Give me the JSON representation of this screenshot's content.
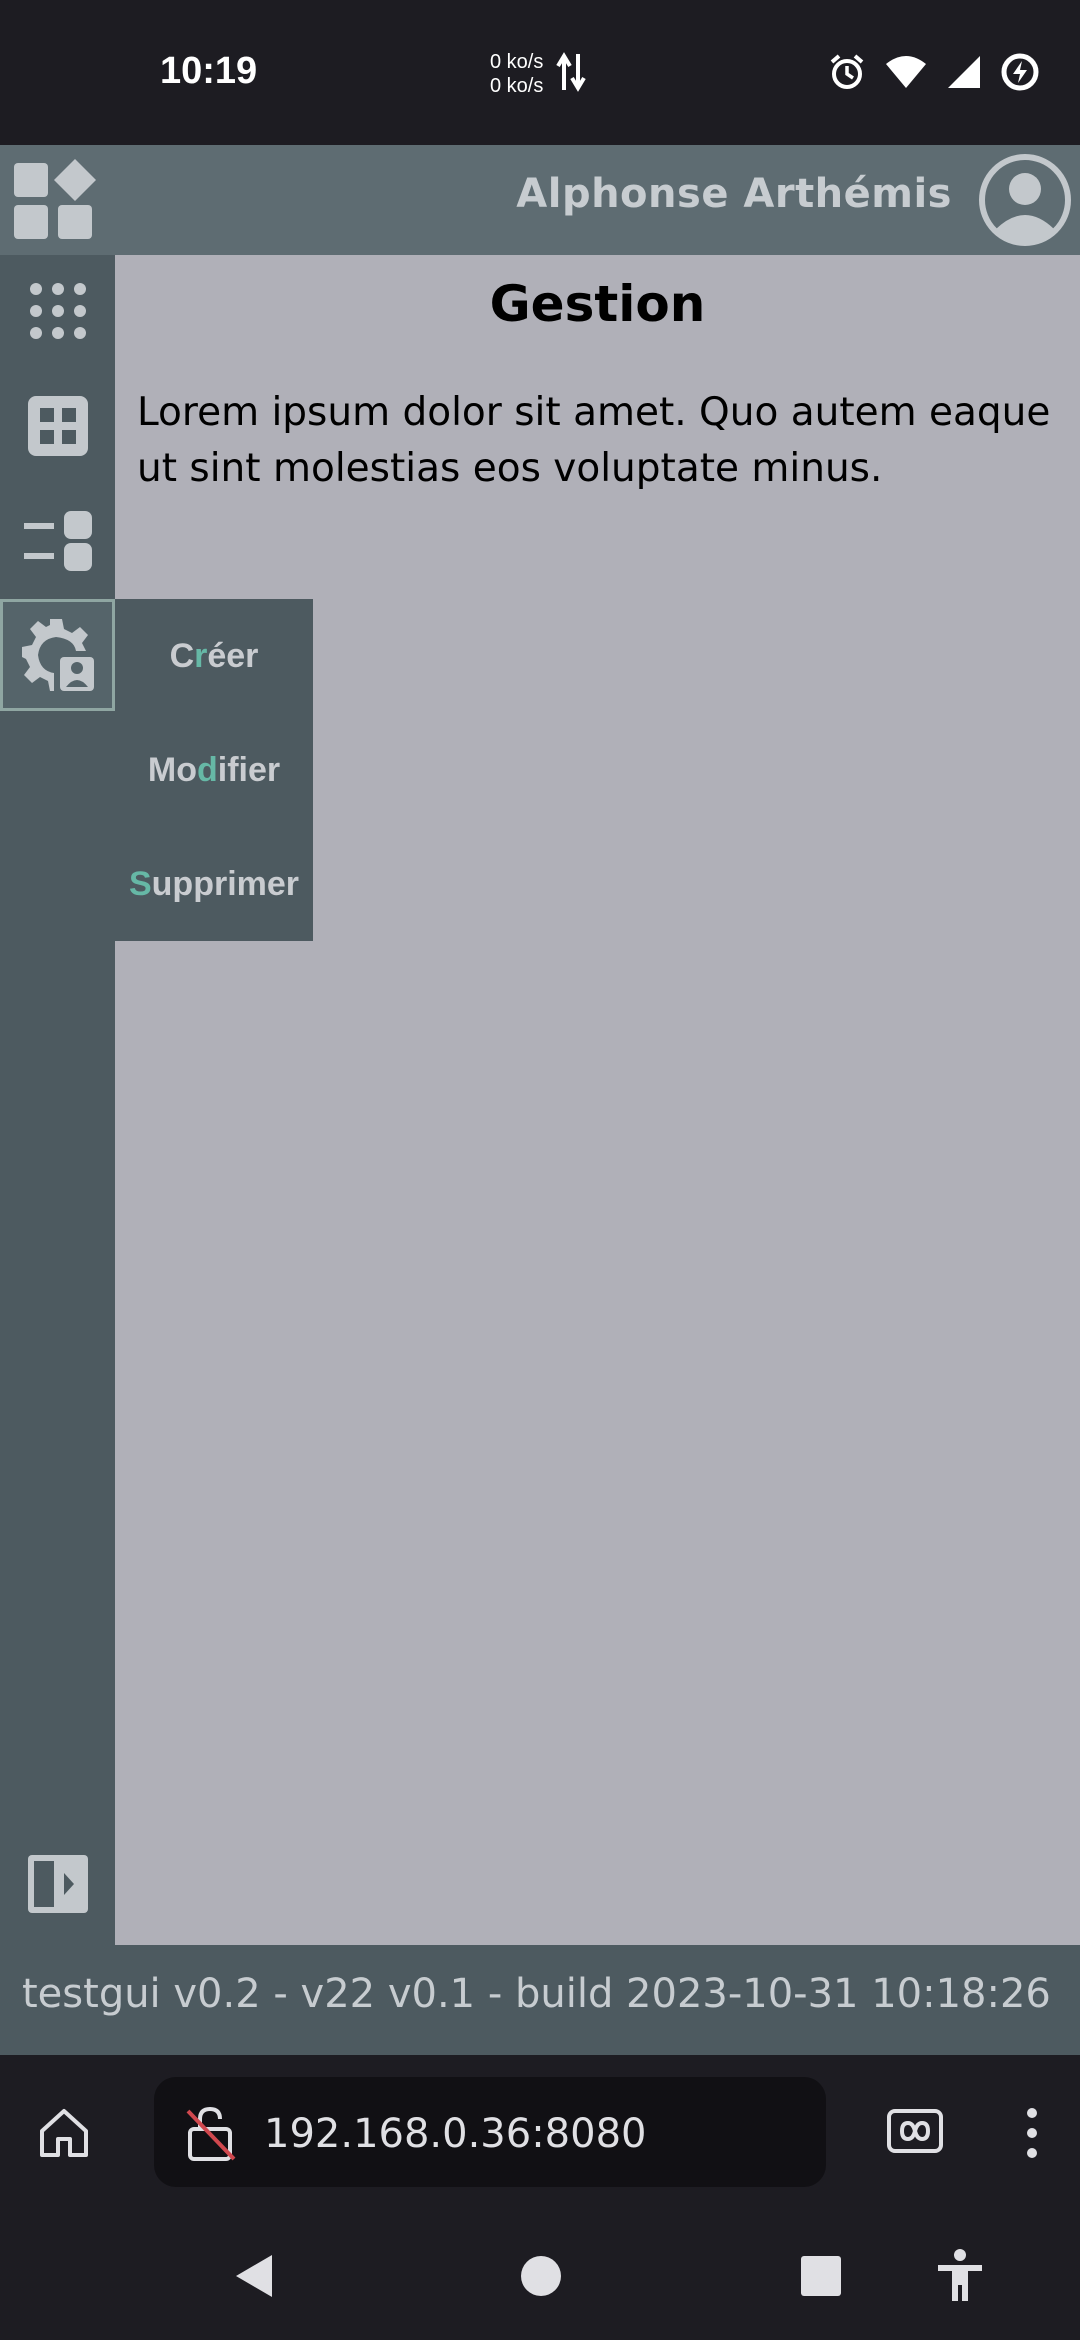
{
  "status_bar": {
    "time": "10:19",
    "net_up": "0 ko/s",
    "net_down": "0 ko/s",
    "icons": [
      "alarm-icon",
      "wifi-icon",
      "cell-signal-icon",
      "battery-saver-icon"
    ]
  },
  "header": {
    "user_name": "Alphonse Arthémis",
    "logo_icon": "apps-logo-icon",
    "avatar_icon": "user-avatar-icon"
  },
  "sidebar": {
    "items": [
      {
        "icon": "dots-grid-icon"
      },
      {
        "icon": "dashboard-grid-icon"
      },
      {
        "icon": "list-toggle-icon"
      },
      {
        "icon": "settings-user-icon",
        "active": true
      }
    ],
    "collapse_icon": "sidebar-toggle-icon"
  },
  "main": {
    "title": "Gestion",
    "text": "Lorem ipsum dolor sit amet. Quo autem eaque ut sint molestias eos voluptate minus."
  },
  "submenu": {
    "items": [
      {
        "pre": "C",
        "hl": "r",
        "post": "éer"
      },
      {
        "pre": "Mo",
        "hl": "d",
        "post": "ifier"
      },
      {
        "pre": "",
        "hl": "S",
        "post": "upprimer"
      }
    ]
  },
  "footer": {
    "text": "testgui v0.2 - v22 v0.1 - build 2023-10-31 10:18:26"
  },
  "browser": {
    "url": "192.168.0.36:8080",
    "icons": [
      "home-icon",
      "insecure-lock-icon",
      "tab-switcher-icon",
      "more-menu-icon"
    ]
  },
  "nav": {
    "icons": [
      "back-icon",
      "home-circle-icon",
      "recents-icon",
      "accessibility-icon"
    ]
  },
  "colors": {
    "header": "#5e6c72",
    "sidebar": "#4d5a60",
    "content": "#b0b0b8",
    "accent": "#66b8a6",
    "system_bar": "#1d1c22"
  }
}
